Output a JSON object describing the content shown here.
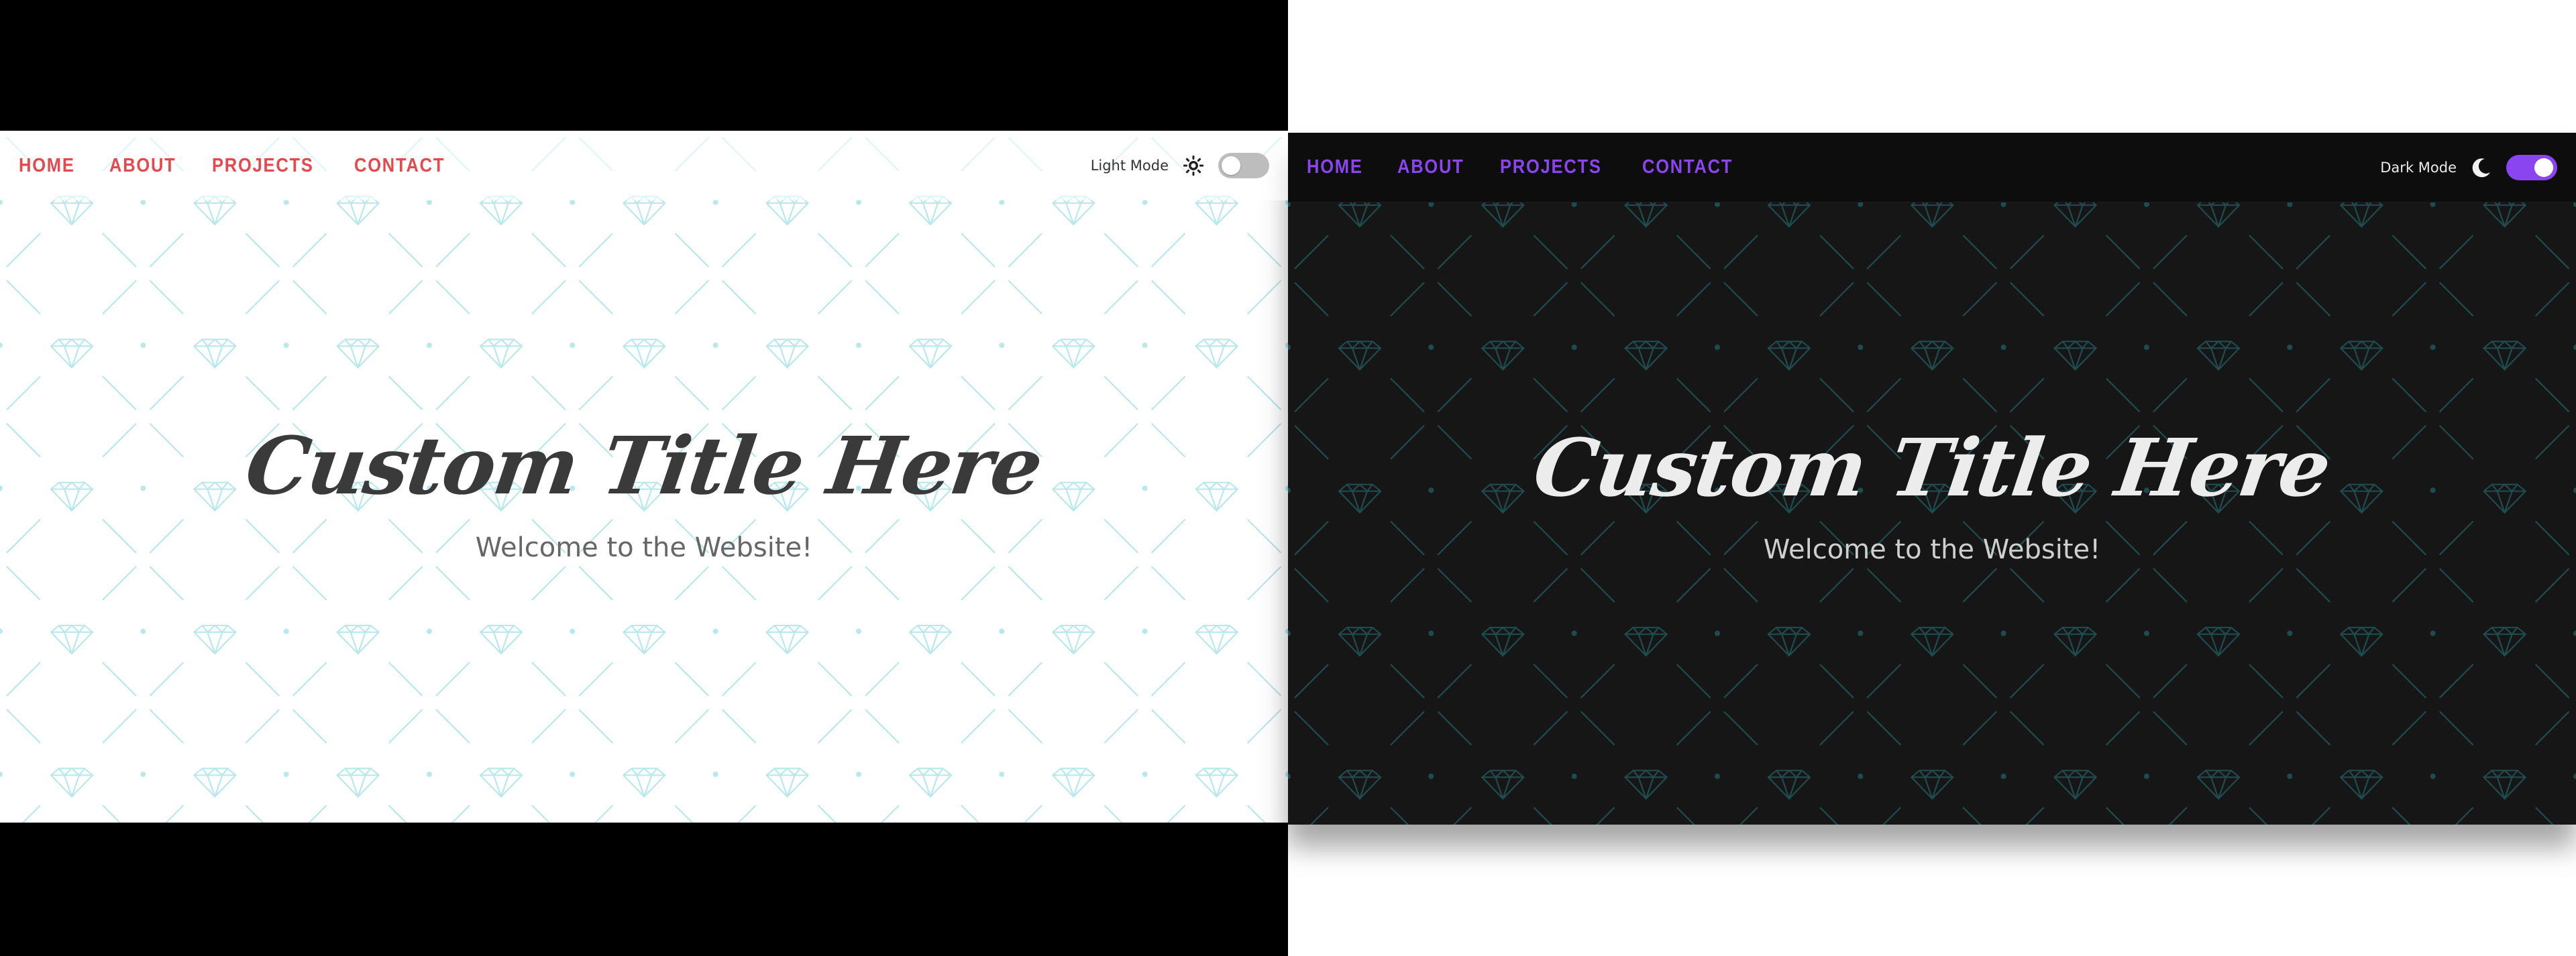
{
  "colors": {
    "light_accent": "#e5484d",
    "dark_accent": "#8b45f0",
    "light_pattern": "#b8e8ea",
    "dark_pattern": "#1f4c4e"
  },
  "light_panel": {
    "nav": {
      "items": [
        {
          "label": "HOME"
        },
        {
          "label": "ABOUT"
        },
        {
          "label": "PROJECTS"
        },
        {
          "label": "CONTACT"
        }
      ]
    },
    "theme": {
      "label": "Light Mode",
      "icon": "sun-icon",
      "toggle_on": false
    },
    "hero": {
      "title": "Custom Title Here",
      "subtitle": "Welcome to the Website!"
    }
  },
  "dark_panel": {
    "nav": {
      "items": [
        {
          "label": "HOME"
        },
        {
          "label": "ABOUT"
        },
        {
          "label": "PROJECTS"
        },
        {
          "label": "CONTACT"
        }
      ]
    },
    "theme": {
      "label": "Dark Mode",
      "icon": "moon-icon",
      "toggle_on": true
    },
    "hero": {
      "title": "Custom Title Here",
      "subtitle": "Welcome to the Website!"
    }
  }
}
